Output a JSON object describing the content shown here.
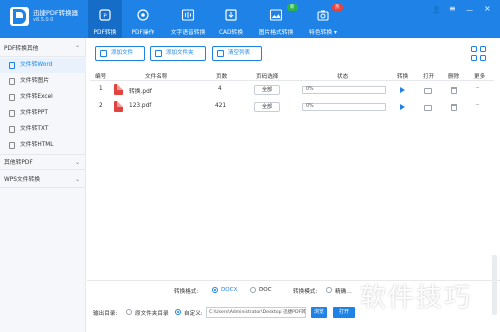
{
  "app": {
    "name": "迅捷PDF转换器",
    "version": "v8.5.0.0"
  },
  "nav": [
    {
      "label": "PDF转换",
      "icon": "pdf-convert-icon",
      "active": true
    },
    {
      "label": "PDF操作",
      "icon": "pdf-operate-icon",
      "active": false
    },
    {
      "label": "文字语音转换",
      "icon": "voice-icon",
      "active": false
    },
    {
      "label": "CAD转换",
      "icon": "cad-icon",
      "active": false
    },
    {
      "label": "图片格式转换",
      "icon": "image-icon",
      "active": false,
      "badge": "新"
    },
    {
      "label": "特色转换 ▾",
      "icon": "camera-icon",
      "active": false,
      "badge": "热"
    }
  ],
  "sidebar": {
    "group1": "PDF转换其他",
    "items": [
      {
        "label": "文件转Word",
        "active": true
      },
      {
        "label": "文件转图片",
        "active": false
      },
      {
        "label": "文件转Excel",
        "active": false
      },
      {
        "label": "文件转PPT",
        "active": false
      },
      {
        "label": "文件转TXT",
        "active": false
      },
      {
        "label": "文件转HTML",
        "active": false
      }
    ],
    "group2": "其他转PDF",
    "group3": "WPS文件转换"
  },
  "toolbar": {
    "add_file": "添加文件",
    "add_folder": "添加文件夹",
    "clear_list": "清空列表"
  },
  "table": {
    "headers": [
      "编号",
      "文件名称",
      "页数",
      "页码选择",
      "状态",
      "转换",
      "打开",
      "删除",
      "更多"
    ],
    "rows": [
      {
        "num": "1",
        "name": "转换.pdf",
        "pages": "4",
        "page_select": "全部",
        "progress": "0%"
      },
      {
        "num": "2",
        "name": "123.pdf",
        "pages": "421",
        "page_select": "全部",
        "progress": "0%"
      }
    ]
  },
  "bottom": {
    "format_label": "转换格式:",
    "format_docx": "DOCX",
    "format_doc": "DOC",
    "mode_label": "转换模式:",
    "mode_option": "精确…",
    "output_label": "输出目录:",
    "output_original": "原文件夹目录",
    "output_custom": "自定义:",
    "path": "C:\\Users\\Administrator\\Desktop 迅捷PDF转换",
    "browse": "浏览",
    "open": "打开"
  },
  "watermark": "软件技巧"
}
